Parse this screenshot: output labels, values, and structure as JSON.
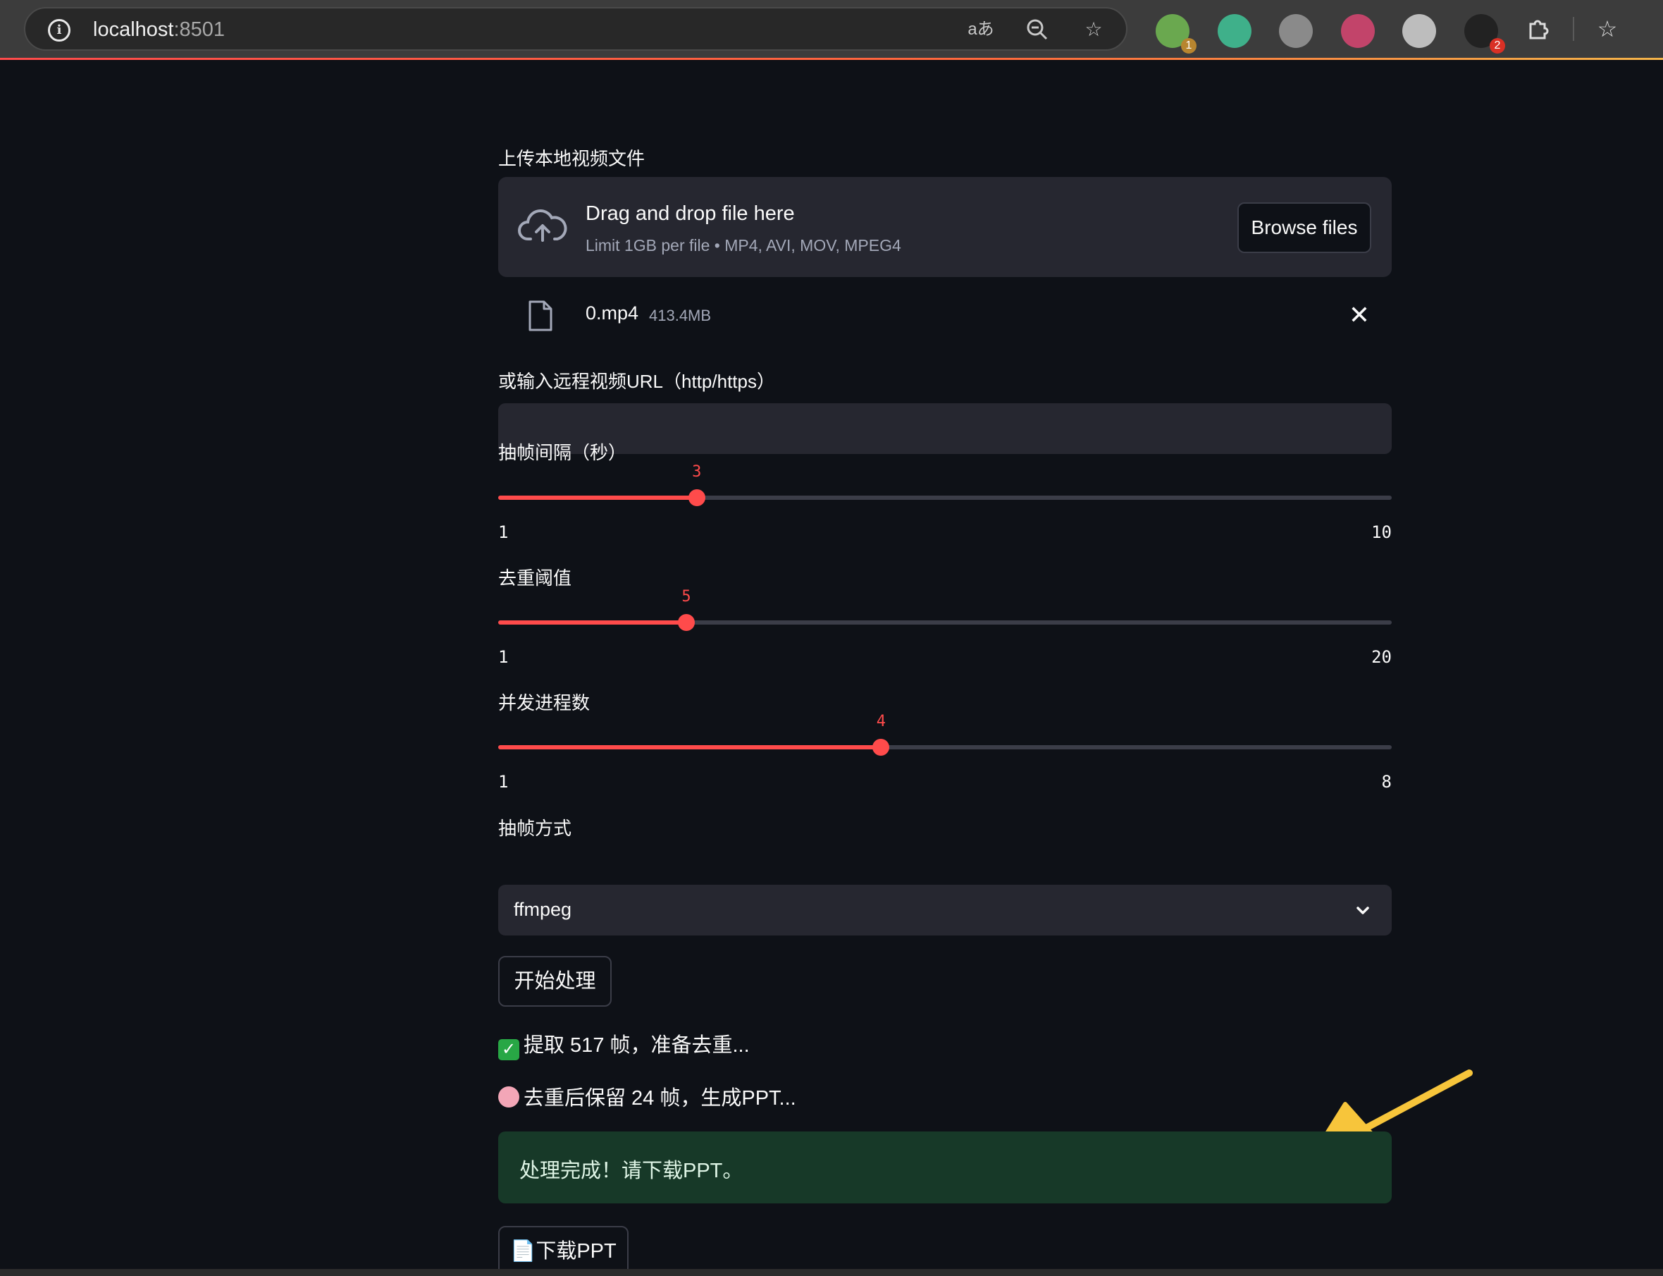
{
  "browser": {
    "url_host": "localhost",
    "url_port": ":8501",
    "extensions": [
      {
        "name": "extension-1",
        "color": "#6aa84f",
        "badge": "1",
        "badge_color": "#b7852f"
      },
      {
        "name": "extension-2",
        "color": "#3fb08a",
        "badge": "",
        "badge_color": ""
      },
      {
        "name": "extension-3",
        "color": "#8a8a8a",
        "badge": "",
        "badge_color": ""
      },
      {
        "name": "extension-4",
        "color": "#c2446a",
        "badge": "",
        "badge_color": ""
      },
      {
        "name": "extension-5",
        "color": "#bdbdbd",
        "badge": "",
        "badge_color": ""
      },
      {
        "name": "extension-6",
        "color": "#222222",
        "badge": "2",
        "badge_color": "#d93025"
      }
    ]
  },
  "uploader": {
    "label": "上传本地视频文件",
    "title": "Drag and drop file here",
    "subtitle": "Limit 1GB per file • MP4, AVI, MOV, MPEG4",
    "button": "Browse files",
    "file_name": "0.mp4",
    "file_size": "413.4MB"
  },
  "url_input": {
    "label": "或输入远程视频URL（http/https）",
    "value": ""
  },
  "sliders": [
    {
      "label": "抽帧间隔（秒）",
      "min": 1,
      "max": 10,
      "value": 3
    },
    {
      "label": "去重阈值",
      "min": 1,
      "max": 20,
      "value": 5
    },
    {
      "label": "并发进程数",
      "min": 1,
      "max": 8,
      "value": 4
    }
  ],
  "method_select": {
    "label": "抽帧方式",
    "value": "ffmpeg"
  },
  "start_button": "开始处理",
  "status": {
    "extract": "提取 517 帧，准备去重...",
    "dedupe": "去重后保留 24 帧，生成PPT..."
  },
  "success": "处理完成！请下载PPT。",
  "download_button": "下载PPT",
  "colors": {
    "accent": "#ff4b4b",
    "background": "#0e1117",
    "widget": "#262730",
    "success_bg": "#173928",
    "annotation_arrow": "#f7c53b"
  }
}
